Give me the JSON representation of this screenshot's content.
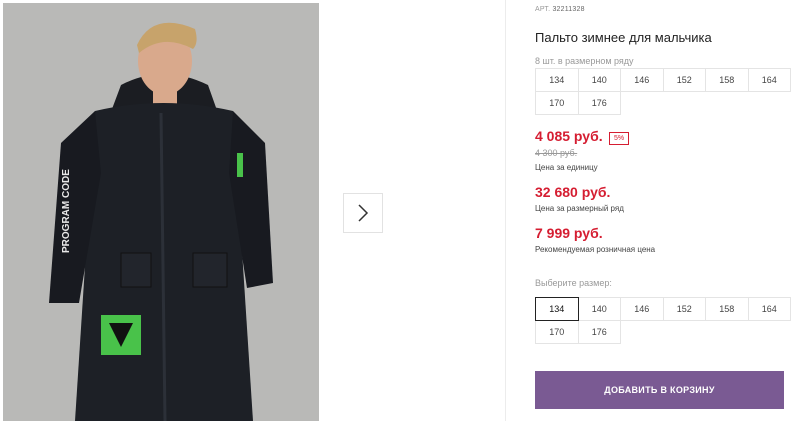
{
  "product": {
    "art_label": "АРТ.",
    "art_number": "32211328",
    "title": "Пальто зимнее для мальчика"
  },
  "size_row": {
    "label": "8 шт. в размерном ряду",
    "sizes": [
      "134",
      "140",
      "146",
      "152",
      "158",
      "164",
      "170",
      "176"
    ]
  },
  "prices": {
    "unit_price": "4 085 руб.",
    "discount": "5%",
    "old_price": "4 300 руб.",
    "unit_caption": "Цена за единицу",
    "row_price": "32 680 руб.",
    "row_caption": "Цена за размерный ряд",
    "retail_price": "7 999 руб.",
    "retail_caption": "Рекомендуемая розничная цена"
  },
  "size_picker": {
    "label": "Выберите размер:",
    "selected": "134",
    "sizes": [
      "134",
      "140",
      "146",
      "152",
      "158",
      "164",
      "170",
      "176"
    ]
  },
  "actions": {
    "add_to_cart": "ДОБАВИТЬ В КОРЗИНУ"
  },
  "gallery": {
    "next_icon": "chevron-right-icon"
  },
  "colors": {
    "accent": "#7a5a93",
    "price_red": "#d51d31"
  }
}
